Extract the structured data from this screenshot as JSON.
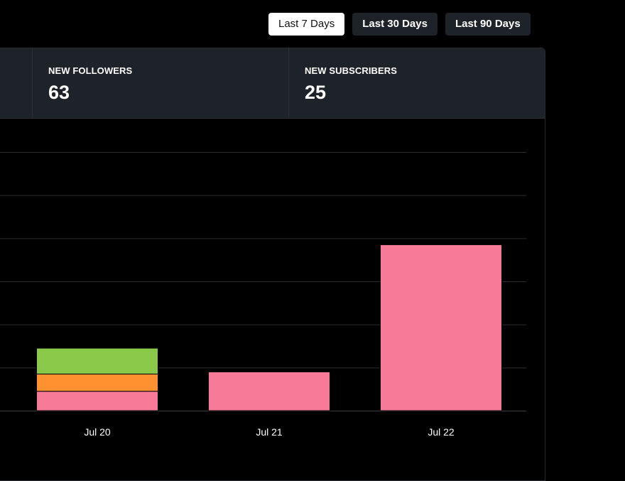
{
  "range_buttons": [
    {
      "label": "Last 7 Days",
      "active": true
    },
    {
      "label": "Last 30 Days",
      "active": false
    },
    {
      "label": "Last 90 Days",
      "active": false
    }
  ],
  "stats": [
    {
      "label": "NEW FOLLOWERS",
      "value": "63"
    },
    {
      "label": "NEW SUBSCRIBERS",
      "value": "25"
    }
  ],
  "colors": {
    "followers": "#f77b98",
    "orange": "#ff9131",
    "green": "#8bc94a",
    "grid": "#2a2d33",
    "panel": "#1e2229"
  },
  "chart_data": {
    "type": "bar",
    "stacked": true,
    "categories": [
      "Jul 20",
      "Jul 21",
      "Jul 22"
    ],
    "series": [
      {
        "color": "#f77b98",
        "values": [
          4.5,
          9,
          38.5
        ]
      },
      {
        "color": "#ff9131",
        "values": [
          4,
          0,
          0
        ]
      },
      {
        "color": "#8bc94a",
        "values": [
          6,
          0,
          0
        ]
      }
    ],
    "ylim": [
      0,
      60
    ],
    "grid": true
  }
}
